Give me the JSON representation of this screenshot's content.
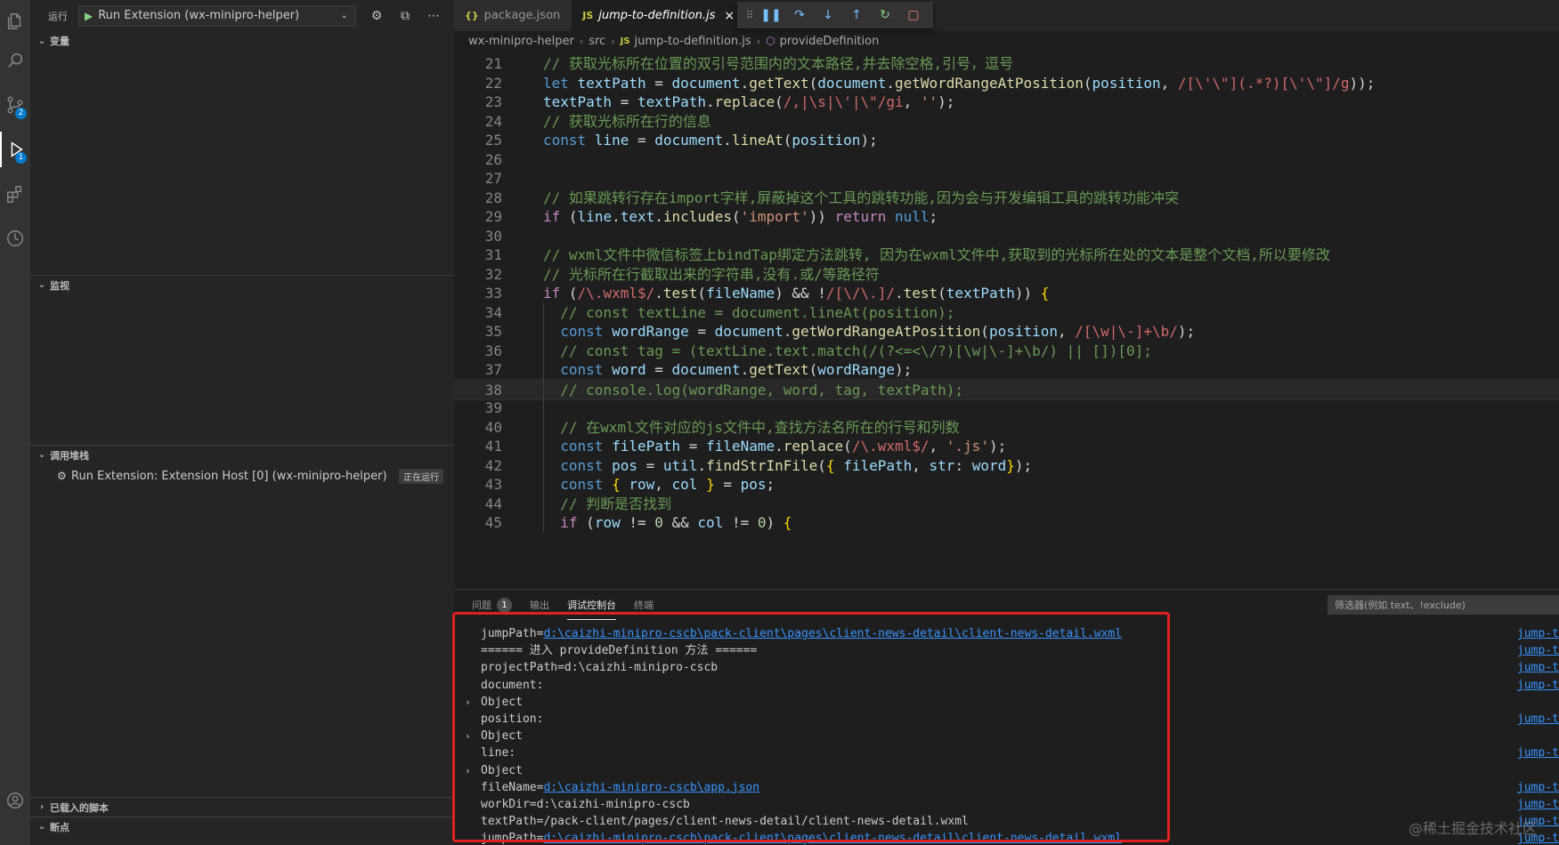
{
  "activity_bar": {
    "source_control_badge": "2",
    "debug_badge": "1"
  },
  "sidebar": {
    "run_title": "运行",
    "run_config": "Run Extension (wx-minipro-helper)",
    "sections": {
      "variables": "变量",
      "watch": "监视",
      "call_stack": "调用堆栈",
      "loaded_scripts": "已载入的脚本",
      "breakpoints": "断点"
    },
    "call_stack_item": {
      "label": "Run Extension: Extension Host [0] (wx-minipro-helper)",
      "status": "正在运行"
    }
  },
  "tabs": [
    {
      "label": "package.json",
      "icon": "{}"
    },
    {
      "label": "jump-to-definition.js",
      "icon": "JS"
    }
  ],
  "breadcrumb": [
    "wx-minipro-helper",
    "src",
    "jump-to-definition.js",
    "provideDefinition"
  ],
  "code_lines": [
    {
      "n": "21",
      "tokens": [
        [
          "c",
          "// 获取光标所在位置的双引号范围内的文本路径,并去除空格,引号，逗号"
        ]
      ]
    },
    {
      "n": "22",
      "tokens": [
        [
          "k",
          "let "
        ],
        [
          "v",
          "textPath"
        ],
        [
          "p",
          " = "
        ],
        [
          "v",
          "document"
        ],
        [
          "p",
          "."
        ],
        [
          "f",
          "getText"
        ],
        [
          "p",
          "("
        ],
        [
          "v",
          "document"
        ],
        [
          "p",
          "."
        ],
        [
          "f",
          "getWordRangeAtPosition"
        ],
        [
          "p",
          "("
        ],
        [
          "v",
          "position"
        ],
        [
          "p",
          ", "
        ],
        [
          "r",
          "/[\\'\\\"](.*?)[\\'\\\"]/g"
        ],
        [
          "p",
          "));"
        ]
      ]
    },
    {
      "n": "23",
      "tokens": [
        [
          "v",
          "textPath"
        ],
        [
          "p",
          " = "
        ],
        [
          "v",
          "textPath"
        ],
        [
          "p",
          "."
        ],
        [
          "f",
          "replace"
        ],
        [
          "p",
          "("
        ],
        [
          "r",
          "/,|\\s|\\'|\\\"/gi"
        ],
        [
          "p",
          ", "
        ],
        [
          "s",
          "''"
        ],
        [
          "p",
          ");"
        ]
      ]
    },
    {
      "n": "24",
      "tokens": [
        [
          "c",
          "// 获取光标所在行的信息"
        ]
      ]
    },
    {
      "n": "25",
      "tokens": [
        [
          "k",
          "const "
        ],
        [
          "v",
          "line"
        ],
        [
          "p",
          " = "
        ],
        [
          "v",
          "document"
        ],
        [
          "p",
          "."
        ],
        [
          "f",
          "lineAt"
        ],
        [
          "p",
          "("
        ],
        [
          "v",
          "position"
        ],
        [
          "p",
          ");"
        ]
      ]
    },
    {
      "n": "26",
      "tokens": []
    },
    {
      "n": "27",
      "tokens": []
    },
    {
      "n": "28",
      "tokens": [
        [
          "c",
          "// 如果跳转行存在import字样,屏蔽掉这个工具的跳转功能,因为会与开发编辑工具的跳转功能冲突"
        ]
      ]
    },
    {
      "n": "29",
      "tokens": [
        [
          "k2",
          "if "
        ],
        [
          "p",
          "("
        ],
        [
          "v",
          "line"
        ],
        [
          "p",
          "."
        ],
        [
          "v",
          "text"
        ],
        [
          "p",
          "."
        ],
        [
          "f",
          "includes"
        ],
        [
          "p",
          "("
        ],
        [
          "s",
          "'import'"
        ],
        [
          "p",
          ")) "
        ],
        [
          "k2",
          "return "
        ],
        [
          "k",
          "null"
        ],
        [
          "p",
          ";"
        ]
      ]
    },
    {
      "n": "30",
      "tokens": []
    },
    {
      "n": "31",
      "tokens": [
        [
          "c",
          "// wxml文件中微信标签上bindTap绑定方法跳转, 因为在wxml文件中,获取到的光标所在处的文本是整个文档,所以要修改"
        ]
      ]
    },
    {
      "n": "32",
      "tokens": [
        [
          "c",
          "// 光标所在行截取出来的字符串,没有.或/等路径符"
        ]
      ]
    },
    {
      "n": "33",
      "tokens": [
        [
          "k2",
          "if "
        ],
        [
          "p",
          "("
        ],
        [
          "r",
          "/\\.wxml$/"
        ],
        [
          "p",
          "."
        ],
        [
          "f",
          "test"
        ],
        [
          "p",
          "("
        ],
        [
          "v",
          "fileName"
        ],
        [
          "p",
          ") && !"
        ],
        [
          "r",
          "/[\\/\\.]/"
        ],
        [
          "p",
          "."
        ],
        [
          "f",
          "test"
        ],
        [
          "p",
          "("
        ],
        [
          "v",
          "textPath"
        ],
        [
          "p",
          ")) "
        ],
        [
          "b",
          "{"
        ]
      ]
    },
    {
      "n": "34",
      "tokens": [
        [
          "i",
          "  "
        ],
        [
          "c",
          "// const textLine = document.lineAt(position);"
        ]
      ]
    },
    {
      "n": "35",
      "tokens": [
        [
          "i",
          "  "
        ],
        [
          "k",
          "const "
        ],
        [
          "v",
          "wordRange"
        ],
        [
          "p",
          " = "
        ],
        [
          "v",
          "document"
        ],
        [
          "p",
          "."
        ],
        [
          "f",
          "getWordRangeAtPosition"
        ],
        [
          "p",
          "("
        ],
        [
          "v",
          "position"
        ],
        [
          "p",
          ", "
        ],
        [
          "r",
          "/[\\w|\\-]+\\b/"
        ],
        [
          "p",
          ");"
        ]
      ]
    },
    {
      "n": "36",
      "tokens": [
        [
          "i",
          "  "
        ],
        [
          "c",
          "// const tag = (textLine.text.match(/(?<=<\\/?)[\\w|\\-]+\\b/) || [])[0];"
        ]
      ]
    },
    {
      "n": "37",
      "tokens": [
        [
          "i",
          "  "
        ],
        [
          "k",
          "const "
        ],
        [
          "v",
          "word"
        ],
        [
          "p",
          " = "
        ],
        [
          "v",
          "document"
        ],
        [
          "p",
          "."
        ],
        [
          "f",
          "getText"
        ],
        [
          "p",
          "("
        ],
        [
          "v",
          "wordRange"
        ],
        [
          "p",
          ");"
        ]
      ]
    },
    {
      "n": "38",
      "tokens": [
        [
          "i",
          "  "
        ],
        [
          "c",
          "// console.log(wordRange, word, tag, textPath);"
        ]
      ]
    },
    {
      "n": "39",
      "tokens": []
    },
    {
      "n": "40",
      "tokens": [
        [
          "i",
          "  "
        ],
        [
          "c",
          "// 在wxml文件对应的js文件中,查找方法名所在的行号和列数"
        ]
      ]
    },
    {
      "n": "41",
      "tokens": [
        [
          "i",
          "  "
        ],
        [
          "k",
          "const "
        ],
        [
          "v",
          "filePath"
        ],
        [
          "p",
          " = "
        ],
        [
          "v",
          "fileName"
        ],
        [
          "p",
          "."
        ],
        [
          "f",
          "replace"
        ],
        [
          "p",
          "("
        ],
        [
          "r",
          "/\\.wxml$/"
        ],
        [
          "p",
          ", "
        ],
        [
          "s",
          "'.js'"
        ],
        [
          "p",
          ");"
        ]
      ]
    },
    {
      "n": "42",
      "tokens": [
        [
          "i",
          "  "
        ],
        [
          "k",
          "const "
        ],
        [
          "v",
          "pos"
        ],
        [
          "p",
          " = "
        ],
        [
          "v",
          "util"
        ],
        [
          "p",
          "."
        ],
        [
          "f",
          "findStrInFile"
        ],
        [
          "p",
          "("
        ],
        [
          "b",
          "{"
        ],
        [
          "p",
          " "
        ],
        [
          "v",
          "filePath"
        ],
        [
          "p",
          ", "
        ],
        [
          "v",
          "str"
        ],
        [
          "p",
          ": "
        ],
        [
          "v",
          "word"
        ],
        [
          "b",
          "}"
        ],
        [
          "p",
          ");"
        ]
      ]
    },
    {
      "n": "43",
      "tokens": [
        [
          "i",
          "  "
        ],
        [
          "k",
          "const "
        ],
        [
          "b",
          "{"
        ],
        [
          "p",
          " "
        ],
        [
          "v",
          "row"
        ],
        [
          "p",
          ", "
        ],
        [
          "v",
          "col"
        ],
        [
          "p",
          " "
        ],
        [
          "b",
          "}"
        ],
        [
          "p",
          " = "
        ],
        [
          "v",
          "pos"
        ],
        [
          "p",
          ";"
        ]
      ]
    },
    {
      "n": "44",
      "tokens": [
        [
          "i",
          "  "
        ],
        [
          "c",
          "// 判断是否找到"
        ]
      ]
    },
    {
      "n": "45",
      "tokens": [
        [
          "i",
          "  "
        ],
        [
          "k2",
          "if "
        ],
        [
          "p",
          "("
        ],
        [
          "v",
          "row"
        ],
        [
          "p",
          " != "
        ],
        [
          "n",
          "0"
        ],
        [
          "p",
          " && "
        ],
        [
          "v",
          "col"
        ],
        [
          "p",
          " != "
        ],
        [
          "n",
          "0"
        ],
        [
          "p",
          ") "
        ],
        [
          "b",
          "{"
        ]
      ]
    }
  ],
  "panel": {
    "tabs": [
      "问题",
      "输出",
      "调试控制台",
      "终端"
    ],
    "problems_badge": "1",
    "filter_placeholder": "筛选器(例如 text、!exclude)"
  },
  "console_lines": [
    {
      "prefix": "jumpPath=",
      "link": "d:\\caizhi-minipro-cscb\\pack-client\\pages\\client-news-detail\\client-news-detail.wxml",
      "src": "jump-t"
    },
    {
      "text": "====== 进入 provideDefinition 方法 ======",
      "src": "jump-t"
    },
    {
      "text": "projectPath=d:\\caizhi-minipro-cscb",
      "src": "jump-t"
    },
    {
      "text": "document:",
      "src": "jump-t"
    },
    {
      "arrow": true,
      "text": "Object"
    },
    {
      "text": "position:",
      "src": "jump-t"
    },
    {
      "arrow": true,
      "text": "Object"
    },
    {
      "text": "line:",
      "src": "jump-t"
    },
    {
      "arrow": true,
      "text": "Object"
    },
    {
      "prefix": "fileName=",
      "link": "d:\\caizhi-minipro-cscb\\app.json",
      "src": "jump-t"
    },
    {
      "text": "workDir=d:\\caizhi-minipro-cscb",
      "src": "jump-t"
    },
    {
      "text": "textPath=/pack-client/pages/client-news-detail/client-news-detail.wxml",
      "src": "jump-t"
    },
    {
      "prefix": "jumpPath=",
      "link": "d:\\caizhi-minipro-cscb\\pack-client\\pages\\client-news-detail\\client-news-detail.wxml",
      "src": "jump-t"
    }
  ],
  "watermark": "@稀土掘金技术社区"
}
